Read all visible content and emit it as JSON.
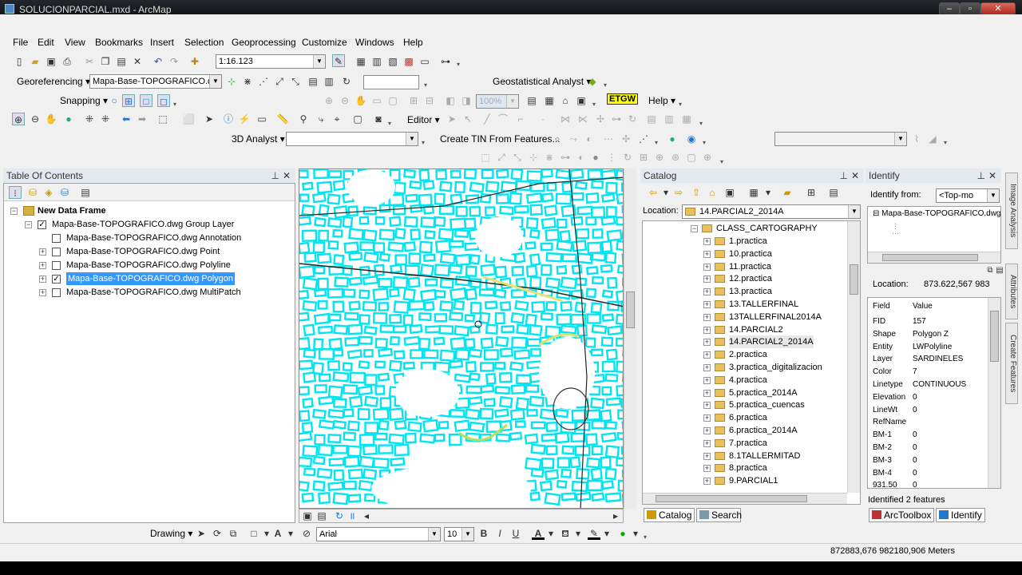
{
  "window": {
    "title": "SOLUCIONPARCIAL.mxd - ArcMap",
    "min": "–",
    "max": "▫",
    "close": "✕"
  },
  "menu": [
    "File",
    "Edit",
    "View",
    "Bookmarks",
    "Insert",
    "Selection",
    "Geoprocessing",
    "Customize",
    "Windows",
    "Help"
  ],
  "toolbars": {
    "scale": "1:16.123",
    "georeferencing_label": "Georeferencing ▾",
    "georef_layer": "Mapa-Base-TOPOGRAFICO.dwg",
    "geostat_label": "Geostatistical Analyst ▾",
    "snapping_label": "Snapping ▾",
    "zoom_value": "100%",
    "etgw": "ETGW",
    "help_label": "Help ▾",
    "editor_label": "Editor ▾",
    "analyst3d_label": "3D Analyst ▾",
    "create_tin": "Create TIN From Features..."
  },
  "toc": {
    "title": "Table Of Contents",
    "frame": "New Data Frame",
    "group": "Mapa-Base-TOPOGRAFICO.dwg Group Layer",
    "layers": [
      {
        "label": "Mapa-Base-TOPOGRAFICO.dwg Annotation",
        "checked": false,
        "expandable": false,
        "selected": false
      },
      {
        "label": "Mapa-Base-TOPOGRAFICO.dwg Point",
        "checked": false,
        "expandable": true,
        "selected": false
      },
      {
        "label": "Mapa-Base-TOPOGRAFICO.dwg Polyline",
        "checked": false,
        "expandable": true,
        "selected": false
      },
      {
        "label": "Mapa-Base-TOPOGRAFICO.dwg Polygon",
        "checked": true,
        "expandable": true,
        "selected": true
      },
      {
        "label": "Mapa-Base-TOPOGRAFICO.dwg MultiPatch",
        "checked": false,
        "expandable": true,
        "selected": false
      }
    ]
  },
  "catalog": {
    "title": "Catalog",
    "location_label": "Location:",
    "location_value": "14.PARCIAL2_2014A",
    "root": "CLASS_CARTOGRAPHY",
    "folders": [
      "1.practica",
      "10.practica",
      "11.practica",
      "12.practica",
      "13.practica",
      "13.TALLERFINAL",
      "13TALLERFINAL2014A",
      "14.PARCIAL2",
      "14.PARCIAL2_2014A",
      "2.practica",
      "3.practica_digitalizacion",
      "4.practica",
      "5.practica_2014A",
      "5.practica_cuencas",
      "6.practica",
      "6.practica_2014A",
      "7.practica",
      "8.1TALLERMITAD",
      "8.practica",
      "9.PARCIAL1"
    ],
    "tab_catalog": "Catalog",
    "tab_search": "Search"
  },
  "identify": {
    "title": "Identify",
    "from_label": "Identify from:",
    "from_value": "<Top-mo",
    "tree_item": "Mapa-Base-TOPOGRAFICO.dwg",
    "location_label": "Location:",
    "location_value": "873.622,567  983",
    "col_field": "Field",
    "col_value": "Value",
    "rows": [
      {
        "f": "FID",
        "v": "157"
      },
      {
        "f": "Shape",
        "v": "Polygon Z"
      },
      {
        "f": "Entity",
        "v": "LWPolyline"
      },
      {
        "f": "Layer",
        "v": "SARDINELES"
      },
      {
        "f": "Color",
        "v": "7"
      },
      {
        "f": "Linetype",
        "v": "CONTINUOUS"
      },
      {
        "f": "Elevation",
        "v": "0"
      },
      {
        "f": "LineWt",
        "v": "0"
      },
      {
        "f": "RefName",
        "v": ""
      },
      {
        "f": "BM-1",
        "v": "0"
      },
      {
        "f": "BM-2",
        "v": "0"
      },
      {
        "f": "BM-3",
        "v": "0"
      },
      {
        "f": "BM-4",
        "v": "0"
      },
      {
        "f": "931.50",
        "v": "0"
      }
    ],
    "status": "Identified 2 features",
    "tab_arctoolbox": "ArcToolbox",
    "tab_identify": "Identify"
  },
  "side_tabs": [
    "Image Analysis",
    "Attributes",
    "Create Features"
  ],
  "drawing": {
    "label": "Drawing ▾",
    "font": "Arial",
    "size": "10",
    "bold": "B",
    "italic": "I",
    "underline": "U"
  },
  "status": {
    "coords": "872883,676  982180,906 Meters"
  },
  "colors": {
    "map_lines": "#00e5f0",
    "selection": "#3399ff"
  }
}
